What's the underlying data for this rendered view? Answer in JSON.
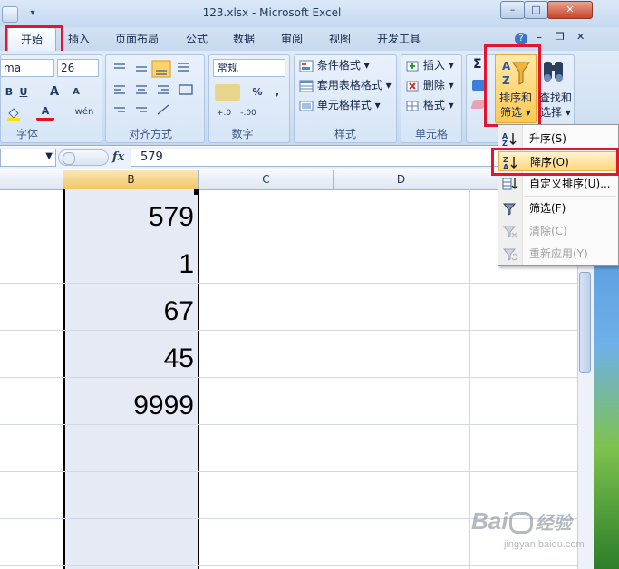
{
  "window": {
    "title": "123.xlsx - Microsoft Excel",
    "minimize": "–",
    "maximize": "□",
    "close": "✕",
    "qat_dropdown": "▾"
  },
  "ribbon_tabs": [
    {
      "label": "开始",
      "active": true
    },
    {
      "label": "插入"
    },
    {
      "label": "页面布局"
    },
    {
      "label": "公式"
    },
    {
      "label": "数据"
    },
    {
      "label": "审阅"
    },
    {
      "label": "视图"
    },
    {
      "label": "开发工具"
    }
  ],
  "ribbon_controls": {
    "help": "?",
    "min": "–",
    "restore": "❐",
    "close": "✕"
  },
  "font_group": {
    "font_name": "ma",
    "font_size": "26",
    "bold": "B",
    "underline": "U",
    "grow": "A",
    "shrink": "A",
    "font_color": "A",
    "phonetic": "wén",
    "label": "字体"
  },
  "align_group": {
    "label": "对齐方式"
  },
  "number_group": {
    "format": "常规",
    "percent": "%",
    "comma": ",",
    "inc_decimal": "+.0",
    "dec_decimal": "-.00",
    "label": "数字"
  },
  "styles_group": {
    "conditional": "条件格式",
    "table": "套用表格格式",
    "cell_styles": "单元格样式",
    "label": "样式"
  },
  "cells_group": {
    "insert": "插入",
    "delete": "删除",
    "format": "格式",
    "label": "单元格"
  },
  "editing_group": {
    "sigma": "Σ",
    "sort_filter_line1": "排序和",
    "sort_filter_line2": "筛选",
    "find_select_line1": "查找和",
    "find_select_line2": "选择"
  },
  "formula_bar": {
    "fx": "fx",
    "value": "579"
  },
  "columns": [
    "B",
    "C",
    "D"
  ],
  "cells": [
    "579",
    "1",
    "67",
    "45",
    "9999"
  ],
  "sort_menu": {
    "items": [
      {
        "label": "升序(S)",
        "icon": "sort-ascending-icon",
        "disabled": false
      },
      {
        "label": "降序(O)",
        "icon": "sort-descending-icon",
        "disabled": false,
        "highlighted": true
      },
      {
        "label": "自定义排序(U)...",
        "icon": "custom-sort-icon",
        "disabled": false
      },
      {
        "label": "筛选(F)",
        "icon": "filter-icon",
        "disabled": false
      },
      {
        "label": "清除(C)",
        "icon": "clear-filter-icon",
        "disabled": true
      },
      {
        "label": "重新应用(Y)",
        "icon": "reapply-icon",
        "disabled": true
      }
    ]
  },
  "watermark": {
    "brand": "Bai",
    "brand2": "经验",
    "url": "jingyan.baidu.com"
  },
  "colors": {
    "highlight_red": "#e2162c",
    "selection_column": "#e6eaf5",
    "menu_hover": "#ffd77c"
  }
}
